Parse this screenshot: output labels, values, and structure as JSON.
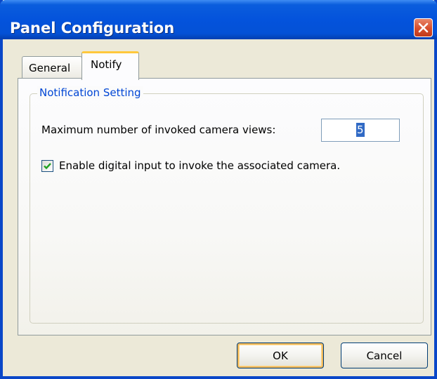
{
  "window": {
    "title": "Panel Configuration"
  },
  "tabs": [
    {
      "label": "General",
      "active": false
    },
    {
      "label": "Notify",
      "active": true
    }
  ],
  "notification_setting": {
    "group_label": "Notification Setting",
    "max_views_label": "Maximum number of invoked camera views:",
    "max_views_value": "5",
    "enable_digital_input_label": "Enable digital input to invoke the associated camera.",
    "enable_digital_input_checked": true
  },
  "buttons": {
    "ok_label": "OK",
    "cancel_label": "Cancel"
  },
  "colors": {
    "title_bar": "#0453dc",
    "close_button": "#d74d2c",
    "group_label": "#0046d5",
    "active_tab_highlight": "#ffc83c",
    "checkmark": "#21a121"
  }
}
